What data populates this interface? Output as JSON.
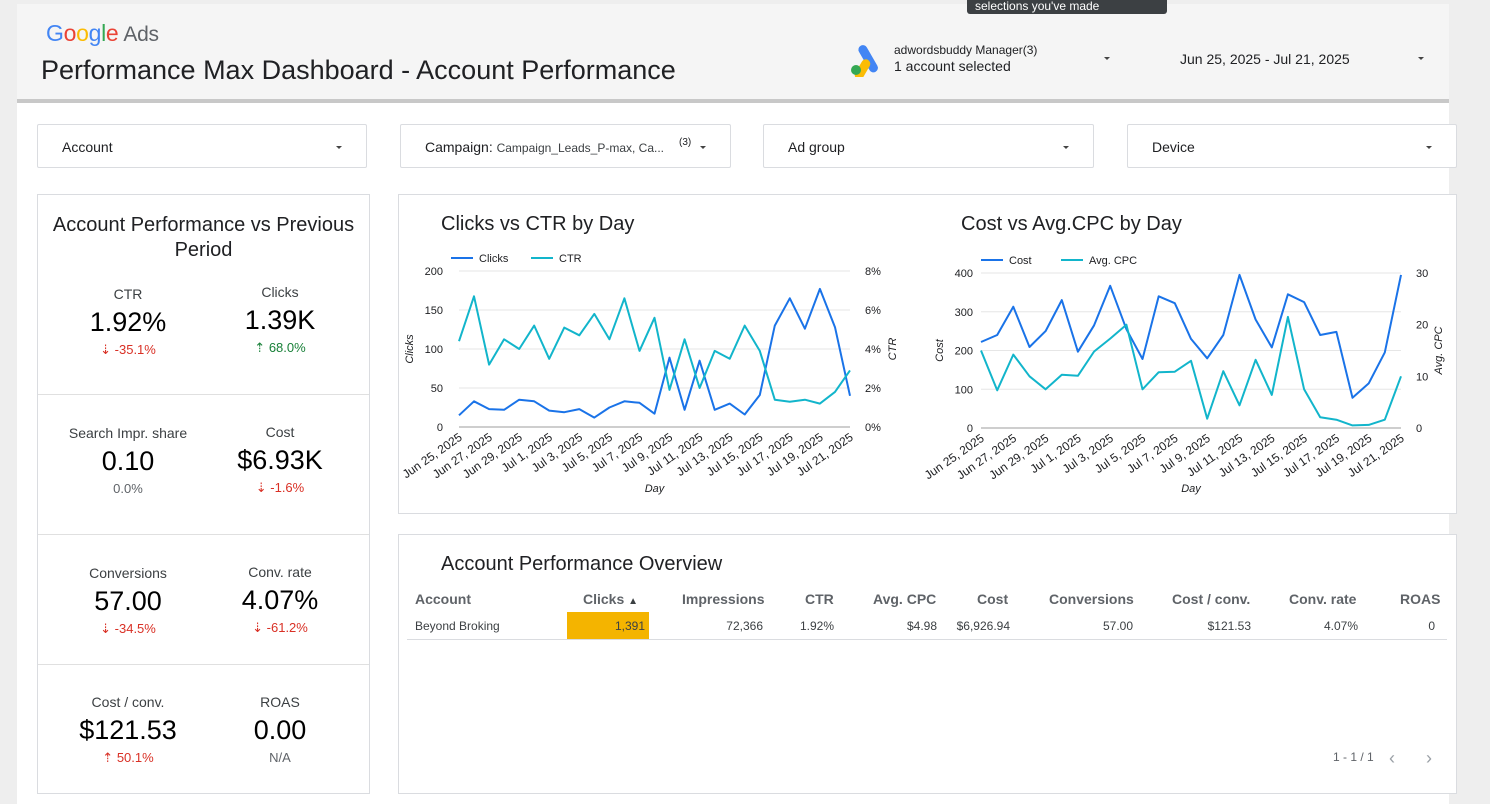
{
  "tooltip": "selections you've made",
  "logo": {
    "google": "Google",
    "ads": "Ads"
  },
  "page_title": "Performance Max Dashboard - Account Performance",
  "account_selector": {
    "name": "adwordsbuddy Manager(3)",
    "selected": "1 account selected"
  },
  "date_range": "Jun 25, 2025 - Jul 21, 2025",
  "filters": {
    "account": "Account",
    "campaign_label": "Campaign:",
    "campaign_value": "Campaign_Leads_P-max, Ca...",
    "campaign_count": "(3)",
    "ad_group": "Ad group",
    "device": "Device"
  },
  "kpi_panel": {
    "title": "Account Performance vs Previous Period",
    "items": [
      {
        "label": "CTR",
        "value": "1.92%",
        "delta": "-35.1%",
        "trend": "down"
      },
      {
        "label": "Clicks",
        "value": "1.39K",
        "delta": "68.0%",
        "trend": "up"
      },
      {
        "label": "Search Impr. share",
        "value": "0.10",
        "delta": "0.0%",
        "trend": "flat"
      },
      {
        "label": "Cost",
        "value": "$6.93K",
        "delta": "-1.6%",
        "trend": "down"
      },
      {
        "label": "Conversions",
        "value": "57.00",
        "delta": "-34.5%",
        "trend": "down"
      },
      {
        "label": "Conv. rate",
        "value": "4.07%",
        "delta": "-61.2%",
        "trend": "down"
      },
      {
        "label": "Cost / conv.",
        "value": "$121.53",
        "delta": "50.1%",
        "trend": "up-bad"
      },
      {
        "label": "ROAS",
        "value": "0.00",
        "delta": "N/A",
        "trend": "flat"
      }
    ]
  },
  "colors": {
    "series_primary": "#1a73e8",
    "series_secondary": "#12b5cb",
    "highlight": "#f4b400",
    "negative": "#d93025",
    "positive": "#188038"
  },
  "chart_data": [
    {
      "type": "line",
      "title": "Clicks vs CTR by Day",
      "xlabel": "Day",
      "ylabel": "Clicks",
      "y2label": "CTR",
      "ylim": [
        0,
        200
      ],
      "y2lim": [
        0,
        8
      ],
      "yticks": [
        "0",
        "50",
        "100",
        "150",
        "200"
      ],
      "y2ticks": [
        "0%",
        "2%",
        "4%",
        "6%",
        "8%"
      ],
      "legend_position": "top-left",
      "x_tick_labels": [
        "Jun 25, 2025",
        "Jun 27, 2025",
        "Jun 29, 2025",
        "Jul 1, 2025",
        "Jul 3, 2025",
        "Jul 5, 2025",
        "Jul 7, 2025",
        "Jul 9, 2025",
        "Jul 11, 2025",
        "Jul 13, 2025",
        "Jul 15, 2025",
        "Jul 17, 2025",
        "Jul 19, 2025",
        "Jul 21, 2025"
      ],
      "x": [
        "Jun 25, 2025",
        "Jun 26, 2025",
        "Jun 27, 2025",
        "Jun 28, 2025",
        "Jun 29, 2025",
        "Jun 30, 2025",
        "Jul 1, 2025",
        "Jul 2, 2025",
        "Jul 3, 2025",
        "Jul 4, 2025",
        "Jul 5, 2025",
        "Jul 6, 2025",
        "Jul 7, 2025",
        "Jul 8, 2025",
        "Jul 9, 2025",
        "Jul 10, 2025",
        "Jul 11, 2025",
        "Jul 12, 2025",
        "Jul 13, 2025",
        "Jul 14, 2025",
        "Jul 15, 2025",
        "Jul 16, 2025",
        "Jul 17, 2025",
        "Jul 18, 2025",
        "Jul 19, 2025",
        "Jul 20, 2025",
        "Jul 21, 2025"
      ],
      "series": [
        {
          "name": "Clicks",
          "axis": "left",
          "values": [
            15,
            33,
            23,
            22,
            35,
            33,
            21,
            19,
            23,
            12,
            25,
            33,
            31,
            17,
            89,
            22,
            85,
            22,
            30,
            16,
            41,
            130,
            165,
            126,
            177,
            128,
            40
          ]
        },
        {
          "name": "CTR",
          "axis": "right",
          "values": [
            4.4,
            6.7,
            3.2,
            4.5,
            4.0,
            5.2,
            3.5,
            5.1,
            4.7,
            5.8,
            4.5,
            6.6,
            3.9,
            5.6,
            1.9,
            4.5,
            2.0,
            3.9,
            3.5,
            5.2,
            3.9,
            1.4,
            1.3,
            1.4,
            1.2,
            1.8,
            2.9
          ]
        }
      ]
    },
    {
      "type": "line",
      "title": "Cost vs Avg.CPC by Day",
      "xlabel": "Day",
      "ylabel": "Cost",
      "y2label": "Avg. CPC",
      "ylim": [
        0,
        400
      ],
      "y2lim": [
        0,
        30
      ],
      "yticks": [
        "0",
        "100",
        "200",
        "300",
        "400"
      ],
      "y2ticks": [
        "0",
        "10",
        "20",
        "30"
      ],
      "legend_position": "top-left",
      "x_tick_labels": [
        "Jun 25, 2025",
        "Jun 27, 2025",
        "Jun 29, 2025",
        "Jul 1, 2025",
        "Jul 3, 2025",
        "Jul 5, 2025",
        "Jul 7, 2025",
        "Jul 9, 2025",
        "Jul 11, 2025",
        "Jul 13, 2025",
        "Jul 15, 2025",
        "Jul 17, 2025",
        "Jul 19, 2025",
        "Jul 21, 2025"
      ],
      "x": [
        "Jun 25, 2025",
        "Jun 26, 2025",
        "Jun 27, 2025",
        "Jun 28, 2025",
        "Jun 29, 2025",
        "Jun 30, 2025",
        "Jul 1, 2025",
        "Jul 2, 2025",
        "Jul 3, 2025",
        "Jul 4, 2025",
        "Jul 5, 2025",
        "Jul 6, 2025",
        "Jul 7, 2025",
        "Jul 8, 2025",
        "Jul 9, 2025",
        "Jul 10, 2025",
        "Jul 11, 2025",
        "Jul 12, 2025",
        "Jul 13, 2025",
        "Jul 14, 2025",
        "Jul 15, 2025",
        "Jul 16, 2025",
        "Jul 17, 2025",
        "Jul 18, 2025",
        "Jul 19, 2025",
        "Jul 20, 2025",
        "Jul 21, 2025"
      ],
      "series": [
        {
          "name": "Cost",
          "axis": "left",
          "values": [
            222,
            240,
            313,
            209,
            250,
            330,
            197,
            265,
            367,
            255,
            178,
            340,
            322,
            230,
            180,
            240,
            395,
            280,
            208,
            345,
            325,
            240,
            248,
            78,
            115,
            195,
            395
          ]
        },
        {
          "name": "Avg. CPC",
          "axis": "right",
          "values": [
            15,
            7.3,
            14.2,
            10,
            7.5,
            10.3,
            10.1,
            14.8,
            17.3,
            20,
            7.5,
            10.8,
            10.9,
            13,
            1.8,
            11,
            4.4,
            13.2,
            6.4,
            21.5,
            7.5,
            2.1,
            1.6,
            0.5,
            0.6,
            1.6,
            10
          ]
        }
      ]
    }
  ],
  "table": {
    "title": "Account Performance Overview",
    "headers": [
      "Account",
      "Clicks",
      "Impressions",
      "CTR",
      "Avg. CPC",
      "Cost",
      "Conversions",
      "Cost / conv.",
      "Conv. rate",
      "ROAS"
    ],
    "sort_indicator": "▲",
    "rows": [
      [
        "Beyond Broking",
        "1,391",
        "72,366",
        "1.92%",
        "$4.98",
        "$6,926.94",
        "57.00",
        "$121.53",
        "4.07%",
        "0"
      ]
    ],
    "pagination": "1 - 1 / 1"
  }
}
